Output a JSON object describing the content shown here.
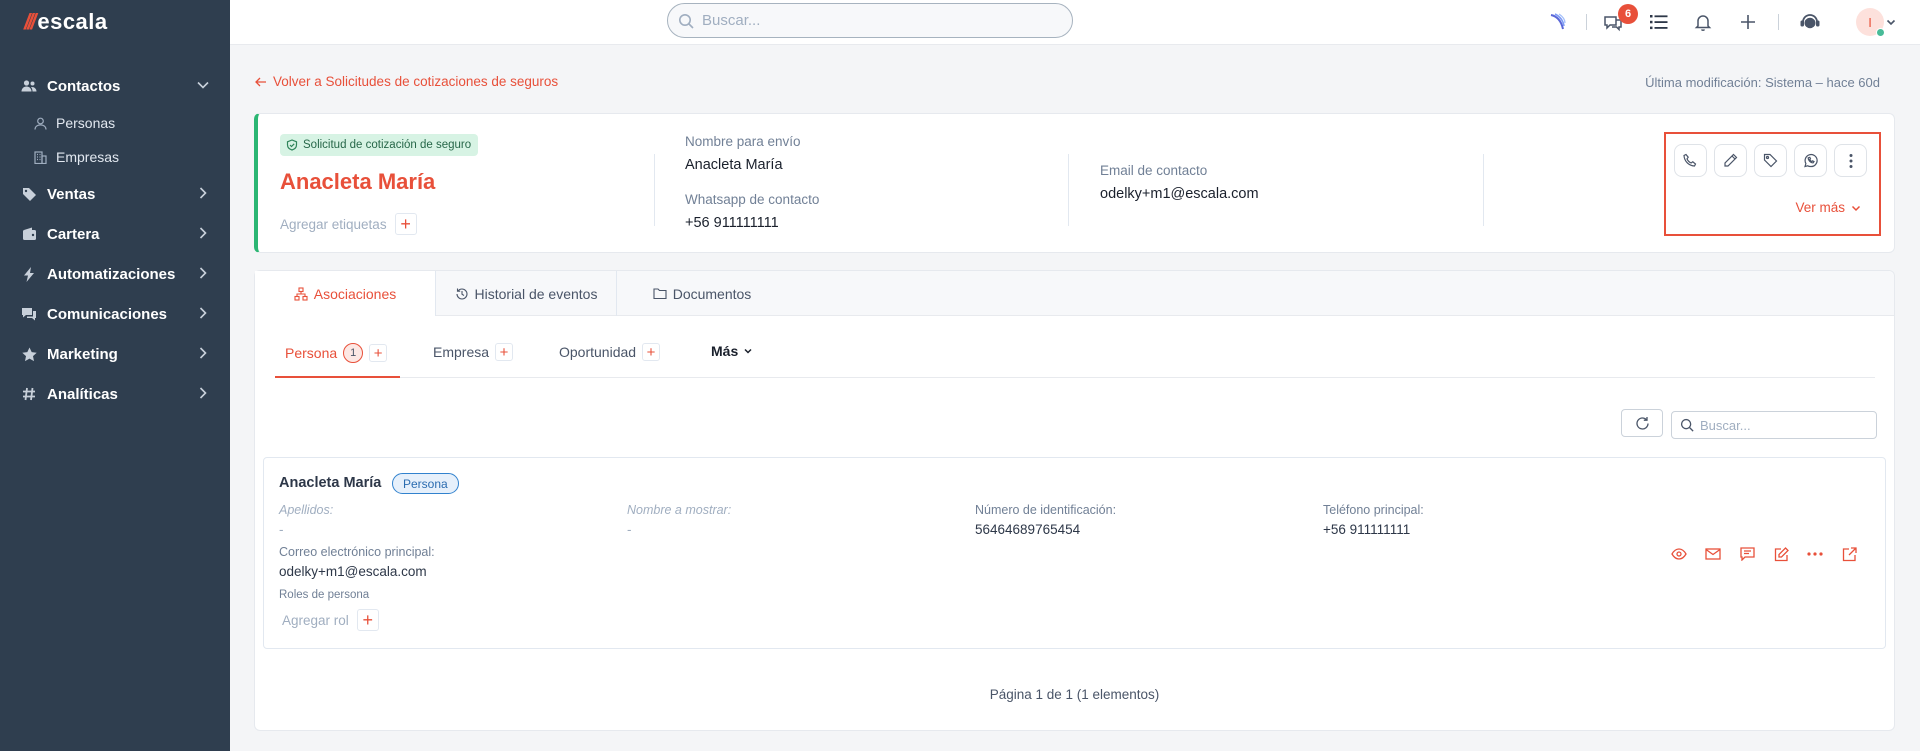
{
  "brand": {
    "name": "escala",
    "accent": "#e8503a",
    "sidebar_bg": "#2f3e4f",
    "success": "#2bb673"
  },
  "topbar": {
    "search_placeholder": "Buscar...",
    "notification_count": "6",
    "avatar_initial": "I"
  },
  "sidebar": {
    "items": [
      {
        "label": "Contactos",
        "icon": "users-icon",
        "expanded": true
      },
      {
        "label": "Personas",
        "icon": "user-icon"
      },
      {
        "label": "Empresas",
        "icon": "building-icon"
      },
      {
        "label": "Ventas",
        "icon": "tag-icon"
      },
      {
        "label": "Cartera",
        "icon": "wallet-icon"
      },
      {
        "label": "Automatizaciones",
        "icon": "bolt-icon"
      },
      {
        "label": "Comunicaciones",
        "icon": "chat-icon"
      },
      {
        "label": "Marketing",
        "icon": "star-icon"
      },
      {
        "label": "Analíticas",
        "icon": "hash-icon"
      }
    ]
  },
  "page": {
    "back_link": "Volver a Solicitudes de cotizaciones de seguros",
    "last_modified": "Última modificación: Sistema – hace 60d"
  },
  "header_card": {
    "type_tag": "Solicitud de cotización de seguro",
    "name": "Anacleta María",
    "add_tags": "Agregar etiquetas",
    "fields": {
      "nombre_envio_label": "Nombre para envío",
      "nombre_envio_value": "Anacleta María",
      "whatsapp_label": "Whatsapp de contacto",
      "whatsapp_value": "+56 911111111",
      "email_label": "Email de contacto",
      "email_value": "odelky+m1@escala.com"
    },
    "actions": [
      "phone-icon",
      "edit-icon",
      "tag-icon",
      "whatsapp-icon",
      "more-vertical-icon"
    ],
    "ver_mas": "Ver más"
  },
  "tabs": [
    {
      "label": "Asociaciones",
      "icon": "network-icon",
      "active": true
    },
    {
      "label": "Historial de eventos",
      "icon": "history-icon"
    },
    {
      "label": "Documentos",
      "icon": "folder-icon"
    }
  ],
  "subtabs": [
    {
      "label": "Persona",
      "count": "1",
      "active": true
    },
    {
      "label": "Empresa"
    },
    {
      "label": "Oportunidad"
    },
    {
      "label": "Más"
    }
  ],
  "list": {
    "search_placeholder": "Buscar...",
    "record": {
      "name": "Anacleta María",
      "type": "Persona",
      "apellidos_label": "Apellidos:",
      "apellidos_value": "-",
      "nombre_mostrar_label": "Nombre a mostrar:",
      "nombre_mostrar_value": "-",
      "identificacion_label": "Número de identificación:",
      "identificacion_value": "56464689765454",
      "telefono_label": "Teléfono principal:",
      "telefono_value": "+56 911111111",
      "correo_label": "Correo electrónico principal:",
      "correo_value": "odelky+m1@escala.com",
      "roles_label": "Roles de persona",
      "agregar_rol": "Agregar rol"
    },
    "pagination": "Página 1 de 1 (1 elementos)"
  }
}
